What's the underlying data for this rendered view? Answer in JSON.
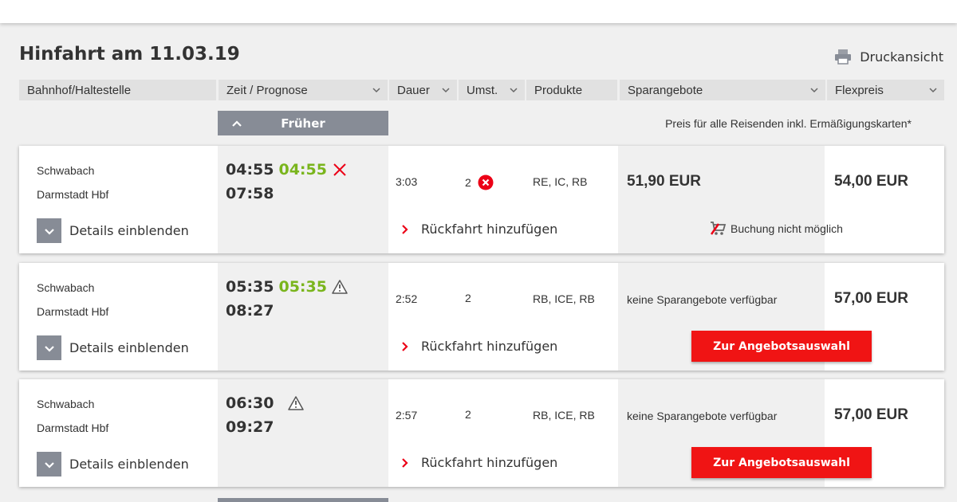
{
  "page": {
    "title": "Hinfahrt am 11.03.19",
    "print_label": "Druckansicht"
  },
  "columns": {
    "station": "Bahnhof/Haltestelle",
    "time": "Zeit / Prognose",
    "duration": "Dauer",
    "changes": "Umst.",
    "products": "Produkte",
    "savers": "Sparangebote",
    "flex": "Flexpreis"
  },
  "earlier_label": "Früher",
  "price_note": "Preis für alle Reisenden inkl. Ermäßigungskarten*",
  "connections": [
    {
      "from": "Schwabach",
      "to": "Darmstadt Hbf",
      "dep": "04:55",
      "dep_prog": "04:55",
      "arr": "07:58",
      "indicator": "cancelled-x-icon",
      "duration": "3:03",
      "changes": "2",
      "changes_warning": "error-circle-icon",
      "products": "RE, IC, RB",
      "saver": "51,90 EUR",
      "flex": "54,00 EUR",
      "details_label": "Details einblenden",
      "return_label": "Rückfahrt hinzufügen",
      "booking_status": "Buchung nicht möglich"
    },
    {
      "from": "Schwabach",
      "to": "Darmstadt Hbf",
      "dep": "05:35",
      "dep_prog": "05:35",
      "arr": "08:27",
      "indicator": "warning-triangle-icon",
      "duration": "2:52",
      "changes": "2",
      "products": "RB, ICE, RB",
      "saver": "keine Sparangebote verfügbar",
      "flex": "57,00 EUR",
      "details_label": "Details einblenden",
      "return_label": "Rückfahrt hinzufügen",
      "offer_button": "Zur Angebotsauswahl"
    },
    {
      "from": "Schwabach",
      "to": "Darmstadt Hbf",
      "dep": "06:30",
      "dep_prog": "",
      "arr": "09:27",
      "indicator": "warning-triangle-icon",
      "duration": "2:57",
      "changes": "2",
      "products": "RB, ICE, RB",
      "saver": "keine Sparangebote verfügbar",
      "flex": "57,00 EUR",
      "details_label": "Details einblenden",
      "return_label": "Rückfahrt hinzufügen",
      "offer_button": "Zur Angebotsauswahl"
    }
  ],
  "colors": {
    "accent_red": "#f01414",
    "prognosis_green": "#7ab51d",
    "button_gray": "#878c96"
  }
}
